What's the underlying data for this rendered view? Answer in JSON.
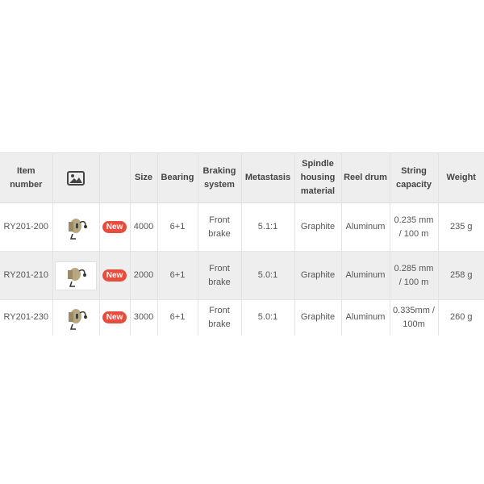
{
  "table": {
    "headers": {
      "item_number": "Item number",
      "image_icon": "image-icon",
      "badge": "",
      "size": "Size",
      "bearing": "Bearing",
      "braking_system": "Braking system",
      "metastasis": "Metastasis",
      "spindle_housing_material": "Spindle housing material",
      "reel_drum": "Reel drum",
      "string_capacity": "String capacity",
      "weight": "Weight"
    },
    "rows": [
      {
        "item_number": "RY201-200",
        "badge": "New",
        "size": "4000",
        "bearing": "6+1",
        "braking_system": "Front brake",
        "metastasis": "5.1:1",
        "spindle_housing_material": "Graphite",
        "reel_drum": "Aluminum",
        "string_capacity": "0.235 mm / 100 m",
        "weight": "235 g"
      },
      {
        "item_number": "RY201-210",
        "badge": "New",
        "size": "2000",
        "bearing": "6+1",
        "braking_system": "Front brake",
        "metastasis": "5.0:1",
        "spindle_housing_material": "Graphite",
        "reel_drum": "Aluminum",
        "string_capacity": "0.285 mm / 100 m",
        "weight": "258 g"
      },
      {
        "item_number": "RY201-230",
        "badge": "New",
        "size": "3000",
        "bearing": "6+1",
        "braking_system": "Front brake",
        "metastasis": "5.0:1",
        "spindle_housing_material": "Graphite",
        "reel_drum": "Aluminum",
        "string_capacity": "0.335mm / 100m",
        "weight": "260 g"
      }
    ]
  },
  "colors": {
    "header_bg": "#eeeeee",
    "badge_bg": "#e84c3d",
    "text": "#555555"
  }
}
